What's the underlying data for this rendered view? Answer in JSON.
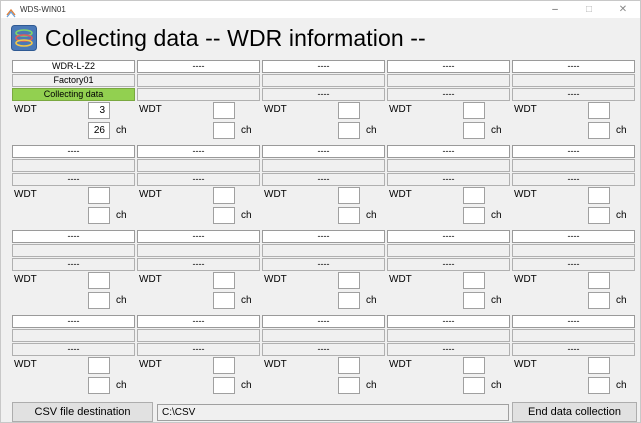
{
  "window": {
    "title": "WDS-WIN01",
    "minimize": "–",
    "maximize": "□",
    "close": "✕"
  },
  "header": {
    "title": "Collecting data -- WDR information --",
    "icon": "collect-data-icon"
  },
  "colors": {
    "status_green": "#92d050",
    "window_bg": "#f0f0f0"
  },
  "devices": [
    {
      "name": "WDR-L-Z2",
      "location": "Factory01",
      "status": "Collecting data",
      "label": "WDT",
      "value1": "3",
      "value2": "26",
      "unit": "ch",
      "active": true
    },
    {
      "name": "----",
      "location": "",
      "status": "",
      "label": "WDT",
      "value1": "",
      "value2": "",
      "unit": "ch",
      "active": false
    },
    {
      "name": "----",
      "location": "",
      "status": "----",
      "label": "WDT",
      "value1": "",
      "value2": "",
      "unit": "ch",
      "active": false
    },
    {
      "name": "----",
      "location": "",
      "status": "----",
      "label": "WDT",
      "value1": "",
      "value2": "",
      "unit": "ch",
      "active": false
    },
    {
      "name": "----",
      "location": "",
      "status": "----",
      "label": "WDT",
      "value1": "",
      "value2": "",
      "unit": "ch",
      "active": false
    },
    {
      "name": "----",
      "location": "",
      "status": "----",
      "label": "WDT",
      "value1": "",
      "value2": "",
      "unit": "ch",
      "active": false
    },
    {
      "name": "----",
      "location": "",
      "status": "----",
      "label": "WDT",
      "value1": "",
      "value2": "",
      "unit": "ch",
      "active": false
    },
    {
      "name": "----",
      "location": "",
      "status": "----",
      "label": "WDT",
      "value1": "",
      "value2": "",
      "unit": "ch",
      "active": false
    },
    {
      "name": "----",
      "location": "",
      "status": "----",
      "label": "WDT",
      "value1": "",
      "value2": "",
      "unit": "ch",
      "active": false
    },
    {
      "name": "----",
      "location": "",
      "status": "----",
      "label": "WDT",
      "value1": "",
      "value2": "",
      "unit": "ch",
      "active": false
    },
    {
      "name": "----",
      "location": "",
      "status": "----",
      "label": "WDT",
      "value1": "",
      "value2": "",
      "unit": "ch",
      "active": false
    },
    {
      "name": "----",
      "location": "",
      "status": "----",
      "label": "WDT",
      "value1": "",
      "value2": "",
      "unit": "ch",
      "active": false
    },
    {
      "name": "----",
      "location": "",
      "status": "----",
      "label": "WDT",
      "value1": "",
      "value2": "",
      "unit": "ch",
      "active": false
    },
    {
      "name": "----",
      "location": "",
      "status": "----",
      "label": "WDT",
      "value1": "",
      "value2": "",
      "unit": "ch",
      "active": false
    },
    {
      "name": "----",
      "location": "",
      "status": "----",
      "label": "WDT",
      "value1": "",
      "value2": "",
      "unit": "ch",
      "active": false
    },
    {
      "name": "----",
      "location": "",
      "status": "----",
      "label": "WDT",
      "value1": "",
      "value2": "",
      "unit": "ch",
      "active": false
    },
    {
      "name": "----",
      "location": "",
      "status": "----",
      "label": "WDT",
      "value1": "",
      "value2": "",
      "unit": "ch",
      "active": false
    },
    {
      "name": "----",
      "location": "",
      "status": "----",
      "label": "WDT",
      "value1": "",
      "value2": "",
      "unit": "ch",
      "active": false
    },
    {
      "name": "----",
      "location": "",
      "status": "----",
      "label": "WDT",
      "value1": "",
      "value2": "",
      "unit": "ch",
      "active": false
    },
    {
      "name": "----",
      "location": "",
      "status": "----",
      "label": "WDT",
      "value1": "",
      "value2": "",
      "unit": "ch",
      "active": false
    }
  ],
  "footer": {
    "csv_button": "CSV file destination",
    "csv_path": "C:\\CSV",
    "end_button": "End data collection"
  }
}
